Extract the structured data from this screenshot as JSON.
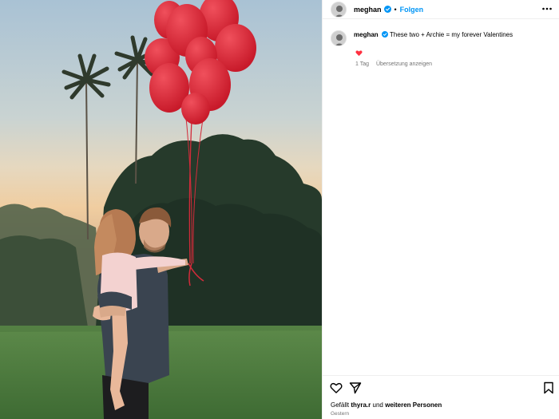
{
  "post": {
    "username": "meghan",
    "follow_label": "Folgen",
    "separator": "•"
  },
  "caption": {
    "username": "meghan",
    "text": "These two + Archie = my forever Valentines"
  },
  "meta": {
    "age": "1 Tag",
    "translate_label": "Übersetzung anzeigen"
  },
  "likes": {
    "prefix": "Gefällt",
    "user": "thyra.r",
    "middle": "und",
    "others": "weiteren Personen"
  },
  "date": "Gestern",
  "icons": {
    "more": "more-options-icon",
    "verified": "verified-badge-icon",
    "like": "heart-icon",
    "share": "send-icon",
    "save": "bookmark-icon",
    "caption_like": "heart-filled-icon"
  },
  "colors": {
    "accent": "#0095f6",
    "heart": "#ff3040",
    "muted": "#737373"
  }
}
